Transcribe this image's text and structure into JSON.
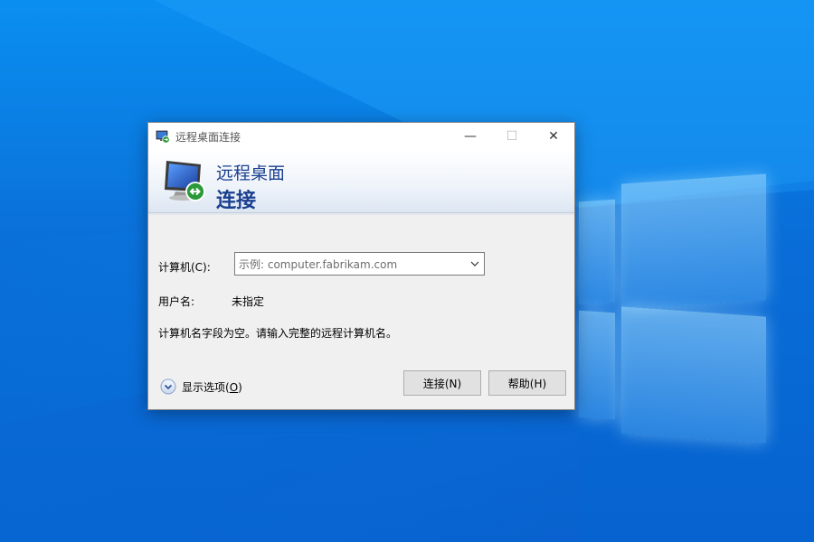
{
  "desktop": {
    "wallpaper": "Windows 10 hero",
    "colors": {
      "background": "#0a74e0",
      "logo_glow": "#aee6ff"
    }
  },
  "dialog": {
    "title": "远程桌面连接",
    "icons": {
      "app": "remote-desktop-icon",
      "options": "chevron-down-circle-icon",
      "dropdown": "chevron-down-icon"
    },
    "window_controls": {
      "minimize": "—",
      "maximize": "☐",
      "close": "✕"
    },
    "banner": {
      "line1": "远程桌面",
      "line2": "连接"
    },
    "computer_label": "计算机(C):",
    "computer_placeholder": "示例: computer.fabrikam.com",
    "username_label": "用户名:",
    "username_value": "未指定",
    "status_message": "计算机名字段为空。请输入完整的远程计算机名。",
    "show_options_text": "显示选项(",
    "show_options_key": "O",
    "show_options_end": ")",
    "connect_button": "连接(N)",
    "help_button": "帮助(H)",
    "colors": {
      "banner_text": "#1b3f8f",
      "dialog_bg": "#f0f0f0"
    }
  }
}
